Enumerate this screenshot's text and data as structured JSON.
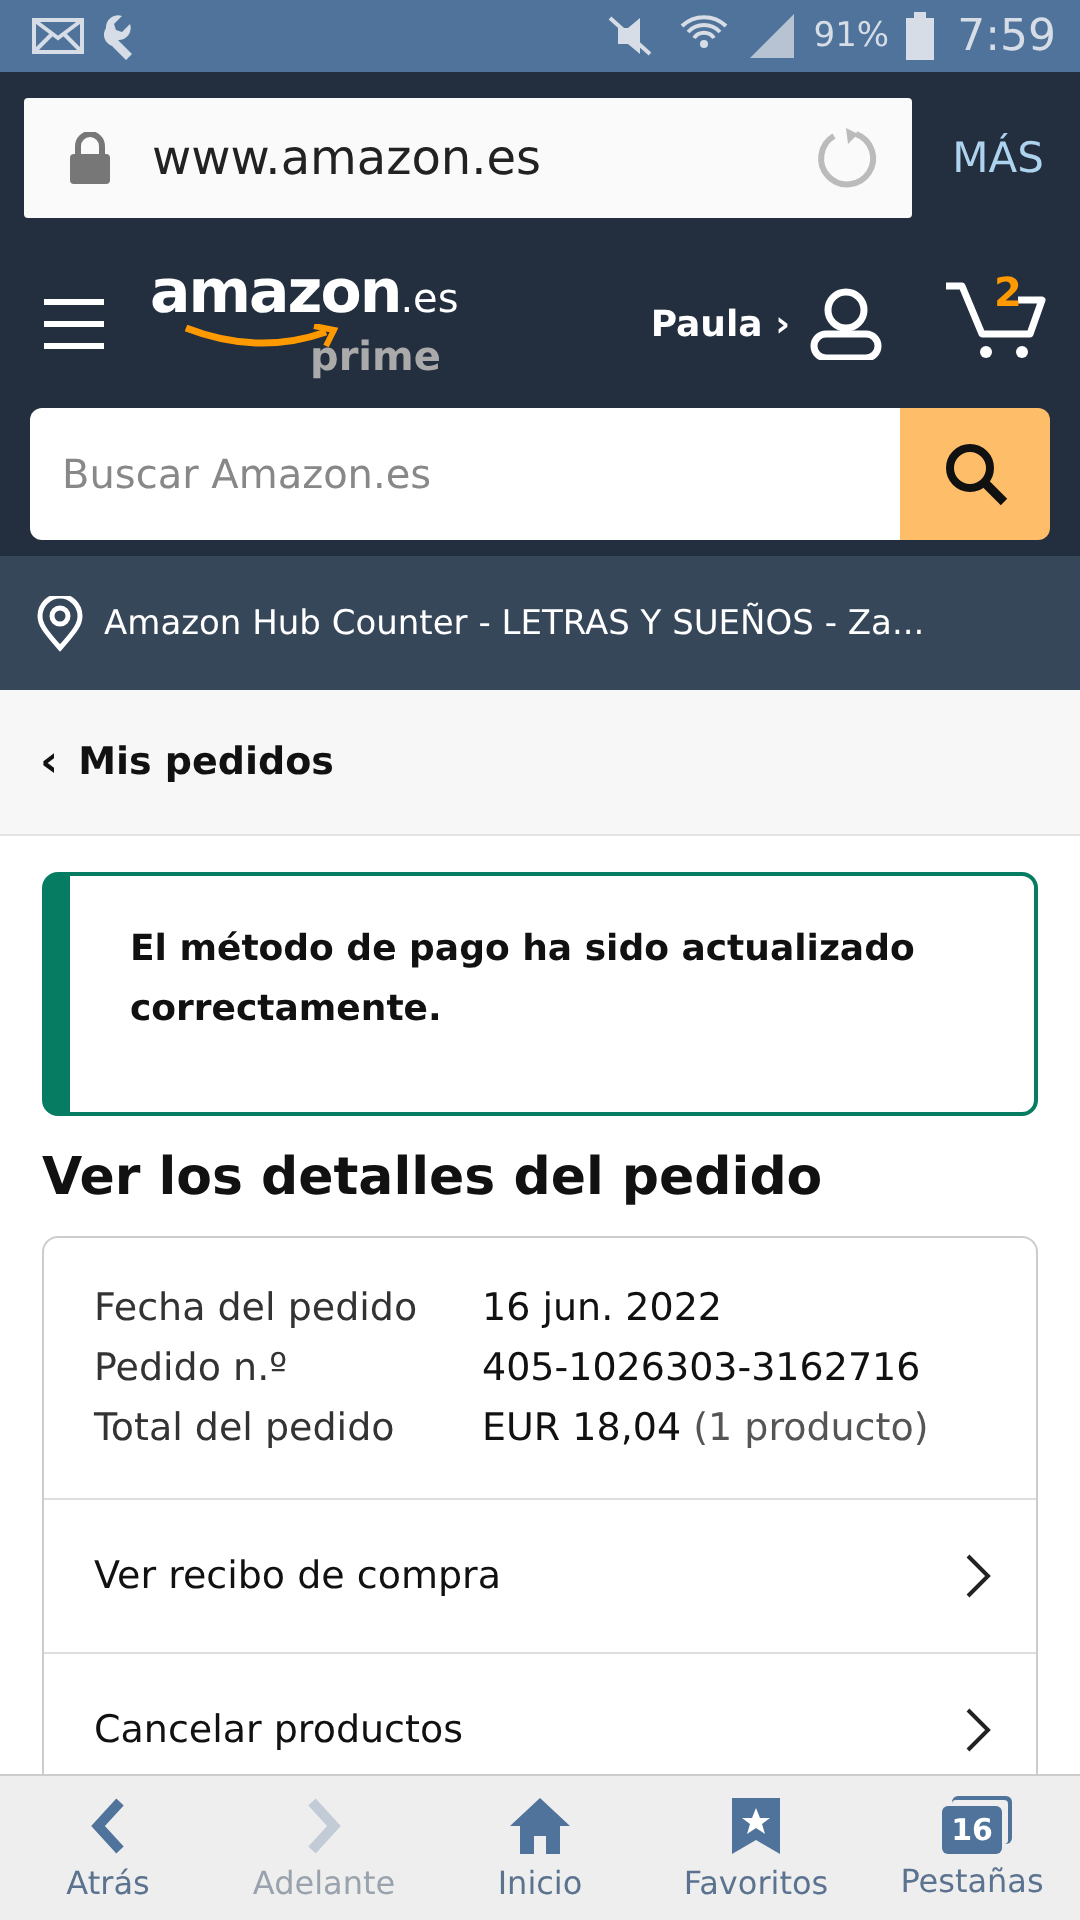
{
  "status_bar": {
    "battery": "91%",
    "time": "7:59"
  },
  "browser": {
    "url": "www.amazon.es",
    "more": "MÁS"
  },
  "header": {
    "logo": "amazon",
    "logo_suffix": ".es",
    "logo_sub": "prime",
    "user": "Paula ›",
    "cart_count": "2"
  },
  "search": {
    "placeholder": "Buscar Amazon.es"
  },
  "location": "Amazon Hub Counter - LETRAS Y SUEÑOS - Za...",
  "breadcrumb": {
    "arrow": "‹",
    "label": "Mis pedidos"
  },
  "alert": "El método de pago ha sido actualizado correctamente.",
  "title": "Ver los detalles del pedido",
  "details": [
    {
      "label": "Fecha del pedido",
      "value": "16 jun. 2022"
    },
    {
      "label": "Pedido n.º",
      "value": "405-1026303-3162716"
    },
    {
      "label": "Total del pedido",
      "value": "EUR 18,04",
      "note": "(1 producto)"
    }
  ],
  "links": [
    "Ver recibo de compra",
    "Cancelar productos"
  ],
  "nav": [
    {
      "kind": "back",
      "label": "Atrás",
      "disabled": false
    },
    {
      "kind": "forward",
      "label": "Adelante",
      "disabled": true
    },
    {
      "kind": "home",
      "label": "Inicio",
      "disabled": false
    },
    {
      "kind": "bookmarks",
      "label": "Favoritos",
      "disabled": false
    },
    {
      "kind": "tabs",
      "label": "Pestañas",
      "disabled": false,
      "count": "16"
    }
  ]
}
